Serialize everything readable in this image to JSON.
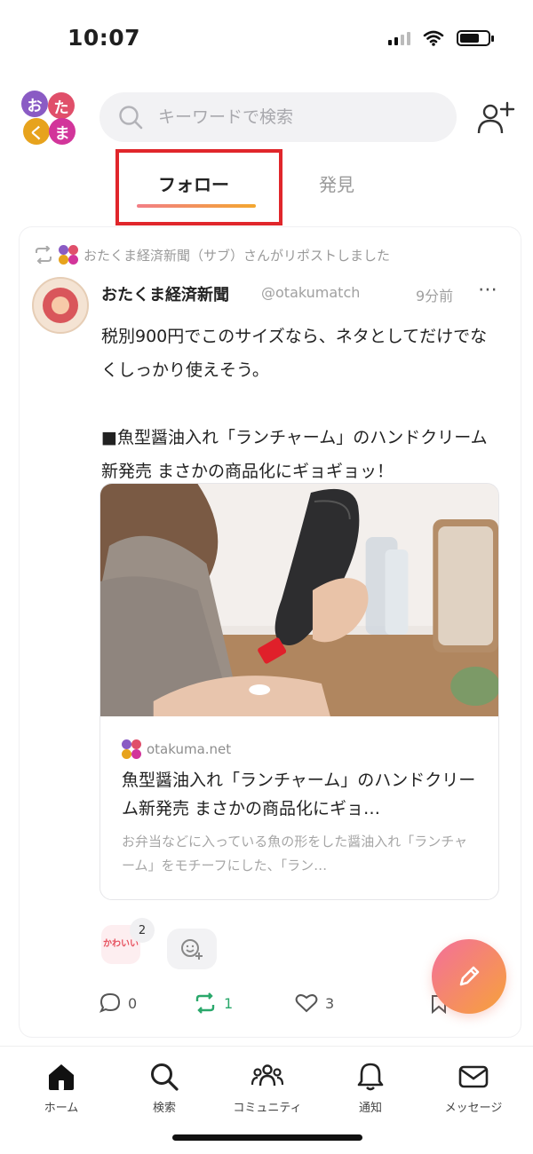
{
  "status_bar": {
    "time": "10:07"
  },
  "header": {
    "logo_chars": [
      "お",
      "た",
      "く",
      "ま"
    ],
    "search": {
      "placeholder": "キーワードで検索",
      "value": ""
    }
  },
  "tabs": [
    {
      "label": "フォロー",
      "active": true
    },
    {
      "label": "発見",
      "active": false
    }
  ],
  "post": {
    "repost_text": "おたくま経済新聞（サブ）さんがリポストしました",
    "author": "おたくま経済新聞",
    "handle": "@otakumatch",
    "time": "9分前",
    "more_icon": "⋯",
    "body": "税別900円でこのサイズなら、ネタとしてだけでなくしっかり使えそう。\n\n■魚型醤油入れ「ランチャーム」のハンドクリーム新発売 まさかの商品化にギョギョッ！",
    "link": {
      "domain": "otakuma.net",
      "title": "魚型醤油入れ「ランチャーム」のハンドクリーム新発売 まさかの商品化にギョ…",
      "description": "お弁当などに入っている魚の形をした醤油入れ「ランチャーム」をモチーフにした、「ラン…"
    },
    "reaction": {
      "stamp_text": "かわいい",
      "count": "2"
    },
    "actions": {
      "comments": "0",
      "reposts": "1",
      "likes": "3"
    }
  },
  "bottom_nav": [
    {
      "label": "ホーム",
      "icon": "home-icon"
    },
    {
      "label": "検索",
      "icon": "search-icon"
    },
    {
      "label": "コミュニティ",
      "icon": "community-icon"
    },
    {
      "label": "通知",
      "icon": "bell-icon"
    },
    {
      "label": "メッセージ",
      "icon": "mail-icon"
    }
  ],
  "colors": {
    "highlight_box": "#e0262b",
    "tab_underline_start": "#f27e86",
    "tab_underline_end": "#f3a72f",
    "repost_green": "#2aa86b",
    "fab_gradient_start": "#f36f9b",
    "fab_gradient_end": "#f7a23a"
  }
}
